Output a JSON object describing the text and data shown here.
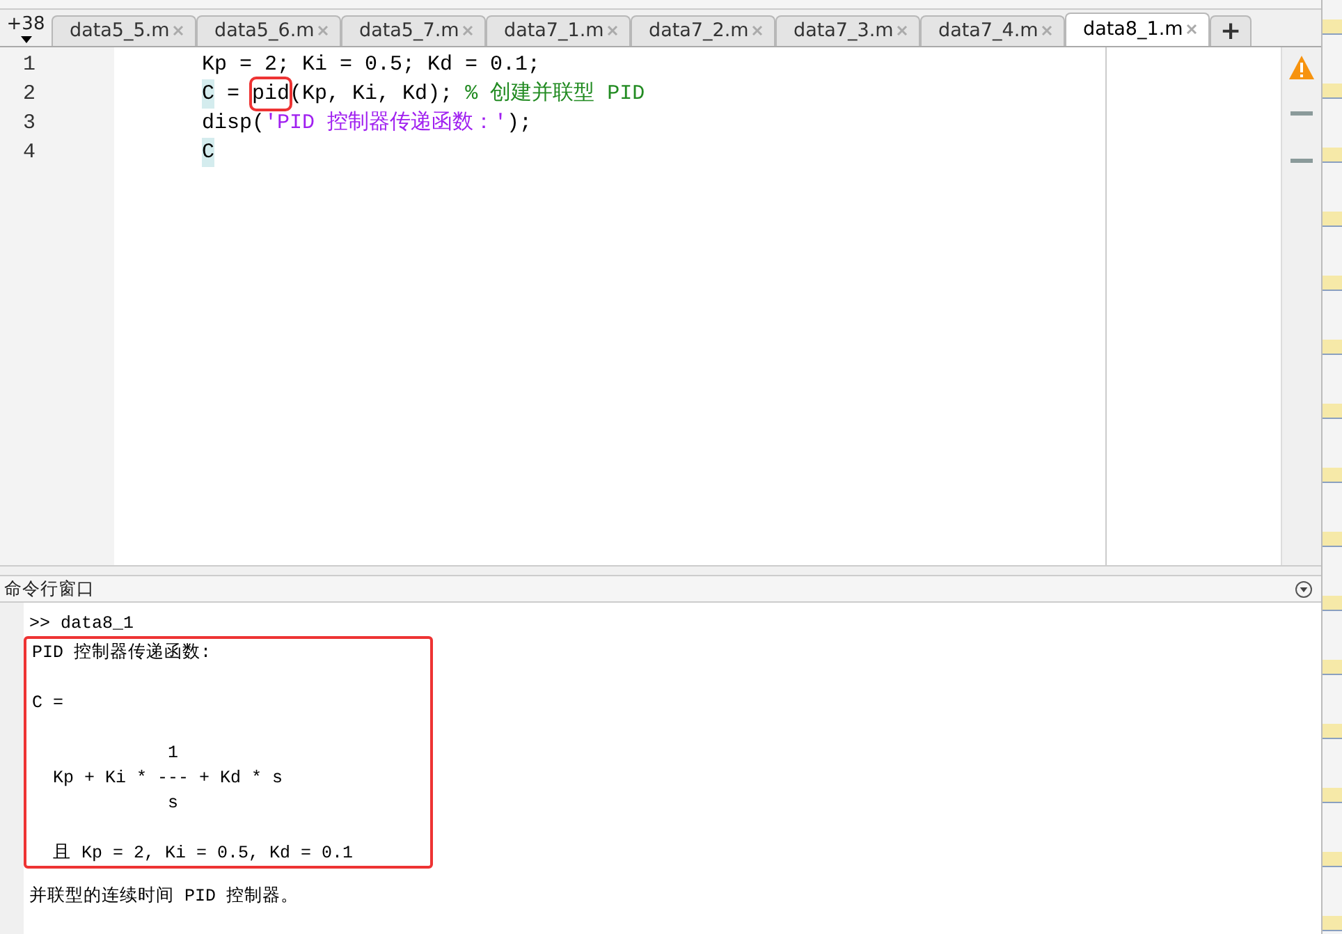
{
  "tab_overflow": {
    "label": "+38"
  },
  "tabs": [
    {
      "label": "data5_5.m",
      "selected": false
    },
    {
      "label": "data5_6.m",
      "selected": false
    },
    {
      "label": "data5_7.m",
      "selected": false
    },
    {
      "label": "data7_1.m",
      "selected": false
    },
    {
      "label": "data7_2.m",
      "selected": false
    },
    {
      "label": "data7_3.m",
      "selected": false
    },
    {
      "label": "data7_4.m",
      "selected": false
    },
    {
      "label": "data8_1.m",
      "selected": true
    }
  ],
  "new_tab": {
    "label": "+"
  },
  "editor": {
    "lines": [
      {
        "number": "1",
        "tokens": [
          {
            "kind": "code",
            "text": "Kp = 2; Ki = 0.5; Kd = 0.1;",
            "highlighted": false
          }
        ]
      },
      {
        "number": "2",
        "tokens": [
          {
            "kind": "variable",
            "text": "C",
            "highlighted": false
          },
          {
            "kind": "code",
            "text": " = ",
            "highlighted": false
          },
          {
            "kind": "code",
            "text": "pid",
            "highlighted": true
          },
          {
            "kind": "code",
            "text": "(Kp, Ki, Kd); ",
            "highlighted": false
          },
          {
            "kind": "comment",
            "text": "% 创建并联型 PID",
            "highlighted": false
          }
        ]
      },
      {
        "number": "3",
        "tokens": [
          {
            "kind": "code",
            "text": "disp(",
            "highlighted": false
          },
          {
            "kind": "string",
            "text": "'PID 控制器传递函数：'",
            "highlighted": false
          },
          {
            "kind": "code",
            "text": ");",
            "highlighted": false
          }
        ]
      },
      {
        "number": "4",
        "tokens": [
          {
            "kind": "variable",
            "text": "C",
            "highlighted": false
          }
        ]
      }
    ]
  },
  "command_window": {
    "title": "命令行窗口",
    "prompt": ">> data8_1",
    "blocks": [
      {
        "highlighted": true,
        "paragraphs": [
          {
            "kind": "text",
            "lines": [
              "PID 控制器传递函数:"
            ]
          },
          {
            "kind": "text",
            "lines": [
              "C ="
            ]
          },
          {
            "kind": "formula",
            "lines": [
              "             1",
              "  Kp + Ki * --- + Kd * s",
              "             s"
            ]
          },
          {
            "kind": "text",
            "lines": [
              "  且 Kp = 2, Ki = 0.5, Kd = 0.1"
            ]
          }
        ]
      },
      {
        "highlighted": false,
        "paragraphs": [
          {
            "kind": "text",
            "lines": [
              "并联型的连续时间 PID 控制器。"
            ]
          }
        ]
      }
    ]
  }
}
